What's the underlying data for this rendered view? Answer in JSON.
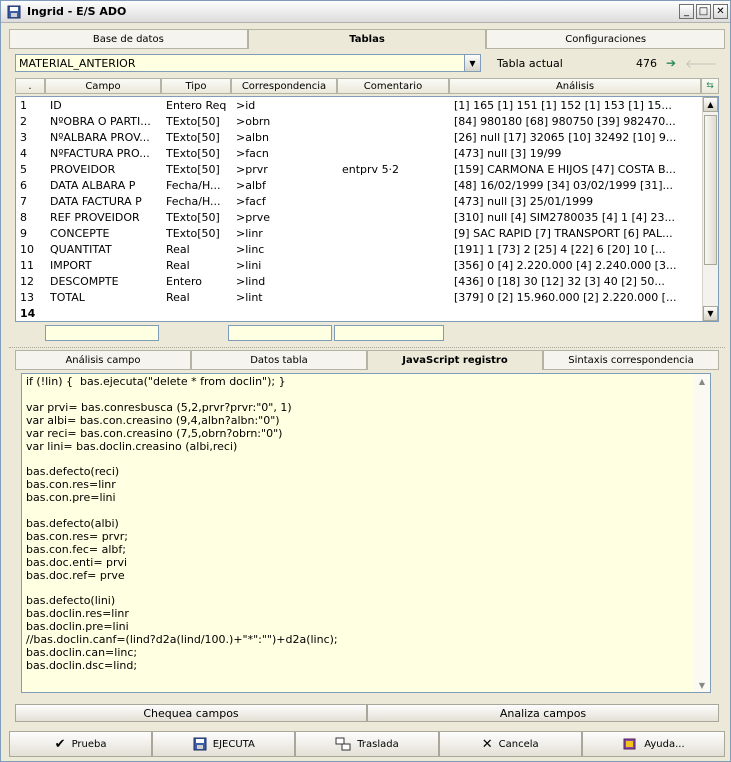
{
  "window": {
    "title": "Ingrid - E/S ADO"
  },
  "top_tabs": [
    "Base de datos",
    "Tablas",
    "Configuraciones"
  ],
  "table_selector": {
    "value": "MATERIAL_ANTERIOR",
    "label": "Tabla actual",
    "count": "476"
  },
  "grid": {
    "headers": [
      ".",
      "Campo",
      "Tipo",
      "Correspondencia",
      "Comentario",
      "Análisis"
    ],
    "rows": [
      [
        "1",
        "ID",
        "Entero Req",
        ">id",
        "",
        "[1] 165  [1] 151  [1] 152  [1] 153  [1] 15..."
      ],
      [
        "2",
        "NºOBRA O PARTI...",
        "TExto[50]",
        ">obrn",
        "",
        "[84] 980180  [68] 980750  [39] 982470..."
      ],
      [
        "3",
        "NºALBARA PROV...",
        "TExto[50]",
        ">albn",
        "",
        "[26] null  [17] 32065  [10] 32492  [10] 9..."
      ],
      [
        "4",
        "NºFACTURA PRO...",
        "TExto[50]",
        ">facn",
        "",
        "[473] null  [3] 19/99"
      ],
      [
        "5",
        "PROVEIDOR",
        "TExto[50]",
        ">prvr",
        "entprv 5·2",
        "[159] CARMONA E HIJOS  [47] COSTA B..."
      ],
      [
        "6",
        "DATA ALBARA P",
        "Fecha/H...",
        ">albf",
        "",
        "[48] 16/02/1999  [34] 03/02/1999  [31]..."
      ],
      [
        "7",
        "DATA FACTURA P",
        "Fecha/H...",
        ">facf",
        "",
        "[473] null  [3] 25/01/1999"
      ],
      [
        "8",
        "REF PROVEIDOR",
        "TExto[50]",
        ">prve",
        "",
        "[310] null  [4] SIM2780035  [4] 1  [4] 23..."
      ],
      [
        "9",
        "CONCEPTE",
        "TExto[50]",
        ">linr",
        "",
        "[9] SAC RAPID  [7] TRANSPORT  [6] PAL..."
      ],
      [
        "10",
        "QUANTITAT",
        "Real",
        ">linc",
        "",
        "[191] 1  [73] 2  [25] 4  [22] 6  [20] 10  [..."
      ],
      [
        "11",
        "IMPORT",
        "Real",
        ">lini",
        "",
        "[356] 0  [4] 2.220.000  [4] 2.240.000  [3..."
      ],
      [
        "12",
        "DESCOMPTE",
        "Entero",
        ">lind",
        "",
        "[436] 0  [18] 30  [12] 32  [3] 40  [2] 50..."
      ],
      [
        "13",
        "TOTAL",
        "Real",
        ">lint",
        "",
        "[379] 0  [2] 15.960.000  [2] 2.220.000  [..."
      ],
      [
        "14",
        "",
        "",
        "",
        "",
        ""
      ]
    ]
  },
  "mid_tabs": [
    "Análisis campo",
    "Datos tabla",
    "JavaScript registro",
    "Sintaxis correspondencia"
  ],
  "script_text": "if (!lin) {  bas.ejecuta(\"delete * from doclin\"); }\n\nvar prvi= bas.conresbusca (5,2,prvr?prvr:\"0\", 1)\nvar albi= bas.con.creasino (9,4,albn?albn:\"0\")\nvar reci= bas.con.creasino (7,5,obrn?obrn:\"0\")\nvar lini= bas.doclin.creasino (albi,reci)\n\nbas.defecto(reci)\nbas.con.res=linr\nbas.con.pre=lini\n\nbas.defecto(albi)\nbas.con.res= prvr;\nbas.con.fec= albf;\nbas.doc.enti= prvi\nbas.doc.ref= prve\n\nbas.defecto(lini)\nbas.doclin.res=linr\nbas.doclin.pre=lini\n//bas.doclin.canf=(lind?d2a(lind/100.)+\"*\":\"\")+d2a(linc);\nbas.doclin.can=linc;\nbas.doclin.dsc=lind;",
  "field_buttons": [
    "Chequea campos",
    "Analiza campos"
  ],
  "action_buttons": [
    {
      "label": "Prueba",
      "icon": "checkmark-icon"
    },
    {
      "label": "EJECUTA",
      "icon": "floppy-disk-icon"
    },
    {
      "label": "Traslada",
      "icon": "transfer-icon"
    },
    {
      "label": "Cancela",
      "icon": "x-cancel-icon"
    },
    {
      "label": "Ayuda...",
      "icon": "help-book-icon"
    }
  ],
  "colors": {
    "field_bg": "#ffffe1",
    "window_bg": "#ece9d8",
    "arrow_active": "#2e8b57"
  }
}
